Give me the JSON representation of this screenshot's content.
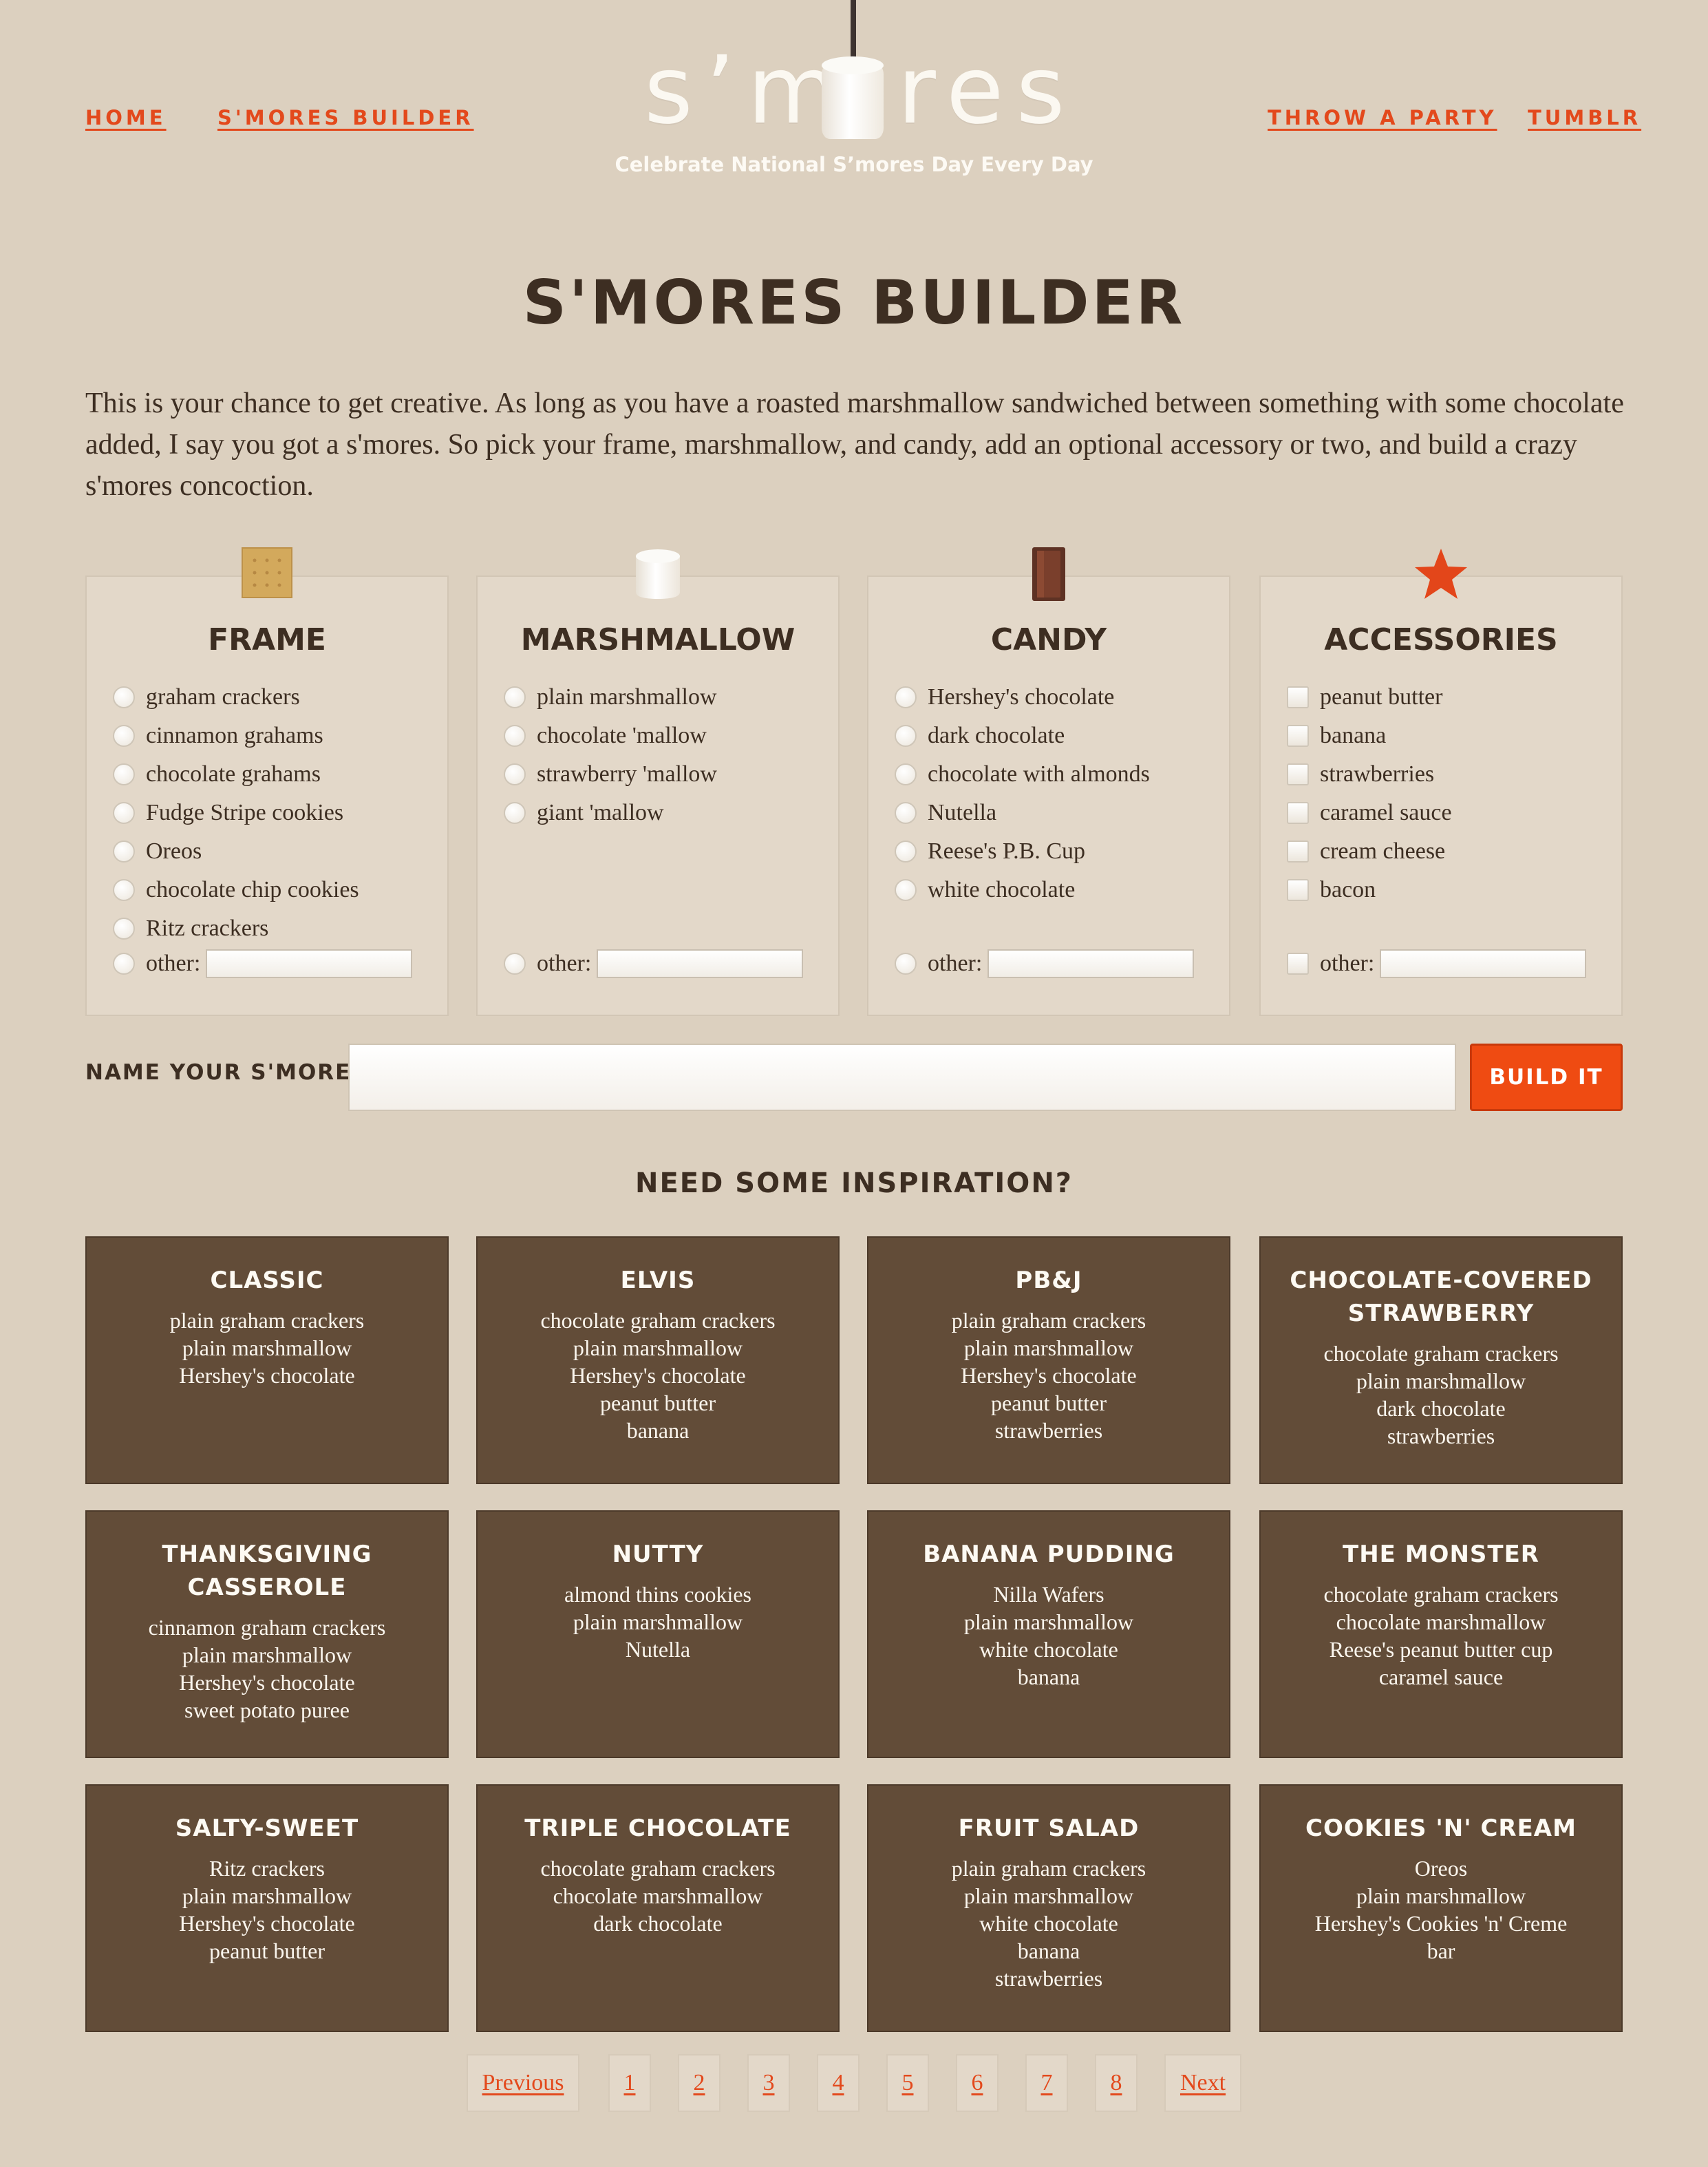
{
  "nav": {
    "left": [
      "HOME",
      "S'MORES BUILDER"
    ],
    "right": [
      "THROW A PARTY",
      "TUMBLR"
    ]
  },
  "logo": {
    "left_text": "s’m",
    "right_text": "res",
    "tagline": "Celebrate National S’mores Day Every Day"
  },
  "page_title": "S'MORES BUILDER",
  "intro": "This is your chance to get creative. As long as you have a roasted marshmallow sandwiched between something with some chocolate added, I say you got a s'mores. So pick your frame, marshmallow, and candy, add an optional accessory or two, and build a crazy s'mores concoction.",
  "builder": {
    "frame": {
      "title": "FRAME",
      "icon": "graham-cracker-icon",
      "options": [
        "graham crackers",
        "cinnamon grahams",
        "chocolate grahams",
        "Fudge Stripe cookies",
        "Oreos",
        "chocolate chip cookies",
        "Ritz crackers"
      ],
      "other_label": "other:"
    },
    "marshmallow": {
      "title": "MARSHMALLOW",
      "icon": "marshmallow-icon",
      "options": [
        "plain marshmallow",
        "chocolate 'mallow",
        "strawberry 'mallow",
        "giant 'mallow"
      ],
      "other_label": "other:"
    },
    "candy": {
      "title": "CANDY",
      "icon": "chocolate-bar-icon",
      "options": [
        "Hershey's chocolate",
        "dark chocolate",
        "chocolate with almonds",
        "Nutella",
        "Reese's P.B. Cup",
        "white chocolate"
      ],
      "other_label": "other:"
    },
    "accessories": {
      "title": "ACCESSORIES",
      "icon": "star-icon",
      "options": [
        "peanut butter",
        "banana",
        "strawberries",
        "caramel sauce",
        "cream cheese",
        "bacon"
      ],
      "other_label": "other:"
    }
  },
  "name_label": "NAME YOUR S'MORES:",
  "build_button": "BUILD IT",
  "inspiration_title": "NEED SOME INSPIRATION?",
  "recipes": [
    {
      "title": "CLASSIC",
      "lines": [
        "plain graham crackers",
        "plain marshmallow",
        "Hershey's chocolate"
      ]
    },
    {
      "title": "ELVIS",
      "lines": [
        "chocolate graham crackers",
        "plain marshmallow",
        "Hershey's chocolate",
        "peanut butter",
        "banana"
      ]
    },
    {
      "title": "PB&J",
      "lines": [
        "plain graham crackers",
        "plain marshmallow",
        "Hershey's chocolate",
        "peanut butter",
        "strawberries"
      ]
    },
    {
      "title": "CHOCOLATE-COVERED STRAWBERRY",
      "lines": [
        "chocolate graham crackers",
        "plain marshmallow",
        "dark chocolate",
        "strawberries"
      ]
    },
    {
      "title": "THANKSGIVING CASSEROLE",
      "lines": [
        "cinnamon graham crackers",
        "plain marshmallow",
        "Hershey's chocolate",
        "sweet potato puree"
      ]
    },
    {
      "title": "NUTTY",
      "lines": [
        "almond thins cookies",
        "plain marshmallow",
        "Nutella"
      ]
    },
    {
      "title": "BANANA PUDDING",
      "lines": [
        "Nilla Wafers",
        "plain marshmallow",
        "white chocolate",
        "banana"
      ]
    },
    {
      "title": "THE MONSTER",
      "lines": [
        "chocolate graham crackers",
        "chocolate marshmallow",
        "Reese's peanut butter cup",
        "caramel sauce"
      ]
    },
    {
      "title": "SALTY-SWEET",
      "lines": [
        "Ritz crackers",
        "plain marshmallow",
        "Hershey's chocolate",
        "peanut butter"
      ]
    },
    {
      "title": "TRIPLE CHOCOLATE",
      "lines": [
        "chocolate graham crackers",
        "chocolate marshmallow",
        "dark chocolate"
      ]
    },
    {
      "title": "FRUIT SALAD",
      "lines": [
        "plain graham crackers",
        "plain marshmallow",
        "white chocolate",
        "banana",
        "strawberries"
      ]
    },
    {
      "title": "COOKIES 'N' CREAM",
      "lines": [
        "Oreos",
        "plain marshmallow",
        "Hershey's Cookies 'n' Creme",
        "bar"
      ]
    }
  ],
  "pagination": {
    "previous": "Previous",
    "pages": [
      "1",
      "2",
      "3",
      "4",
      "5",
      "6",
      "7",
      "8"
    ],
    "next": "Next"
  },
  "colors": {
    "background": "#dcd0bf",
    "accent": "#ef4b12",
    "card": "#624c38",
    "text": "#3d2e22"
  }
}
